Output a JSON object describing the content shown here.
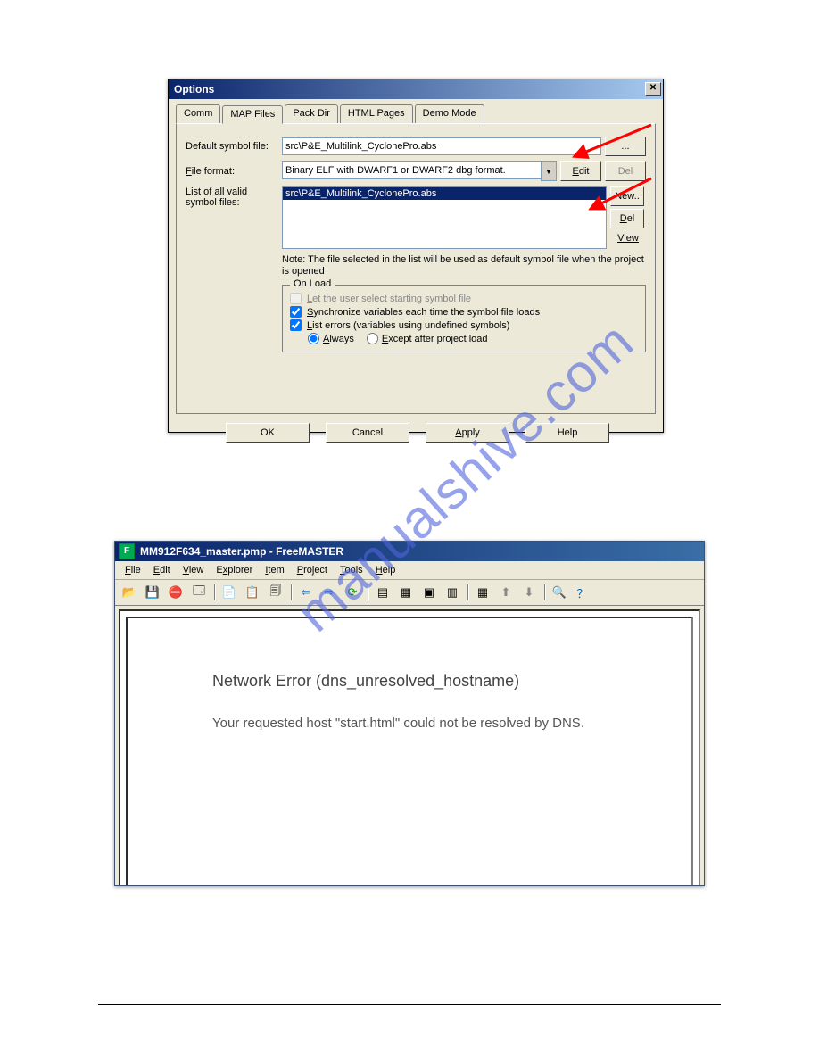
{
  "dialog": {
    "title": "Options",
    "tabs": [
      "Comm",
      "MAP Files",
      "Pack Dir",
      "HTML Pages",
      "Demo Mode"
    ],
    "active_tab": 1,
    "labels": {
      "default_symbol": "Default symbol file:",
      "file_format": "File format:",
      "list_label1": "List of all valid",
      "list_label2": "symbol files:",
      "note": "Note: The file selected in the list will be used as default symbol file when the project is opened"
    },
    "default_symbol_value": "src\\P&E_Multilink_CyclonePro.abs",
    "file_format_value": "Binary ELF with DWARF1 or DWARF2 dbg format.",
    "list_item": "src\\P&E_Multilink_CyclonePro.abs",
    "buttons": {
      "browse": "...",
      "edit": "Edit",
      "del_top": "Del",
      "new": "New..",
      "del": "Del",
      "view": "View"
    },
    "onload": {
      "legend": "On Load",
      "let_user": "Let the user select starting symbol file",
      "sync": "Synchronize variables each time the symbol file loads",
      "list_errors": "List errors (variables using undefined symbols)",
      "always": "Always",
      "except": "Except after project load"
    },
    "footer": {
      "ok": "OK",
      "cancel": "Cancel",
      "apply": "Apply",
      "help": "Help"
    }
  },
  "window": {
    "title": "MM912F634_master.pmp - FreeMASTER",
    "menu": [
      "File",
      "Edit",
      "View",
      "Explorer",
      "Item",
      "Project",
      "Tools",
      "Help"
    ],
    "error_heading": "Network Error (dns_unresolved_hostname)",
    "error_body": "Your requested host \"start.html\" could not be resolved by DNS."
  },
  "watermark": "manualshive.com"
}
